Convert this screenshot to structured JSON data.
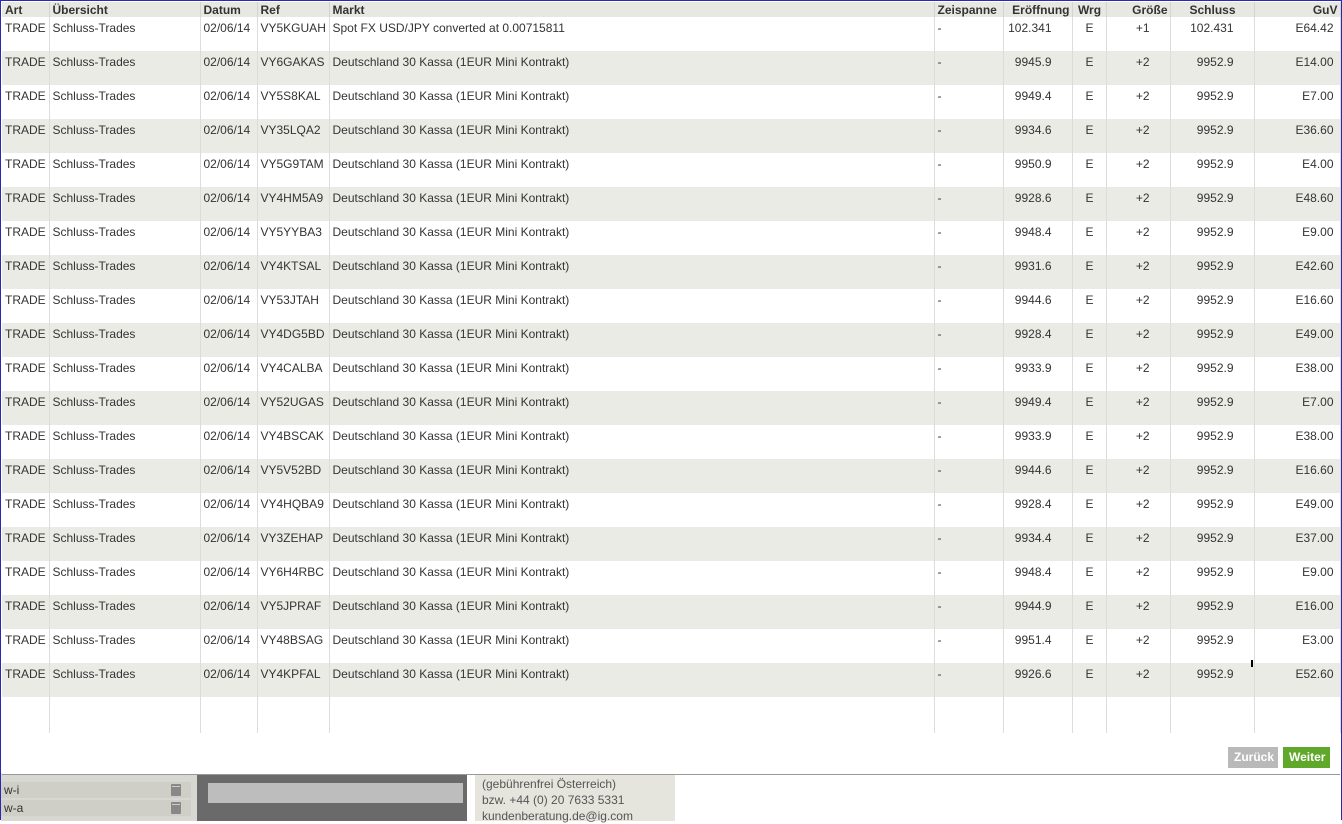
{
  "table": {
    "headers": {
      "art": "Art",
      "uebersicht": "Übersicht",
      "datum": "Datum",
      "ref": "Ref",
      "markt": "Markt",
      "zeispanne": "Zeispanne",
      "eroeffnung": "Eröffnung",
      "wrg": "Wrg",
      "groesse": "Größe",
      "schluss": "Schluss",
      "guv": "GuV"
    },
    "rows": [
      {
        "art": "TRADE",
        "uebersicht": "Schluss-Trades",
        "datum": "02/06/14",
        "ref": "VY5KGUAH",
        "markt": "Spot FX USD/JPY converted at 0.00715811",
        "zeispanne": "-",
        "eroeffnung": "102.341",
        "wrg": "E",
        "groesse": "+1",
        "schluss": "102.431",
        "guv": "E64.42"
      },
      {
        "art": "TRADE",
        "uebersicht": "Schluss-Trades",
        "datum": "02/06/14",
        "ref": "VY6GAKAS",
        "markt": "Deutschland 30 Kassa (1EUR Mini Kontrakt)",
        "zeispanne": "-",
        "eroeffnung": "9945.9",
        "wrg": "E",
        "groesse": "+2",
        "schluss": "9952.9",
        "guv": "E14.00"
      },
      {
        "art": "TRADE",
        "uebersicht": "Schluss-Trades",
        "datum": "02/06/14",
        "ref": "VY5S8KAL",
        "markt": "Deutschland 30 Kassa (1EUR Mini Kontrakt)",
        "zeispanne": "-",
        "eroeffnung": "9949.4",
        "wrg": "E",
        "groesse": "+2",
        "schluss": "9952.9",
        "guv": "E7.00"
      },
      {
        "art": "TRADE",
        "uebersicht": "Schluss-Trades",
        "datum": "02/06/14",
        "ref": "VY35LQA2",
        "markt": "Deutschland 30 Kassa (1EUR Mini Kontrakt)",
        "zeispanne": "-",
        "eroeffnung": "9934.6",
        "wrg": "E",
        "groesse": "+2",
        "schluss": "9952.9",
        "guv": "E36.60"
      },
      {
        "art": "TRADE",
        "uebersicht": "Schluss-Trades",
        "datum": "02/06/14",
        "ref": "VY5G9TAM",
        "markt": "Deutschland 30 Kassa (1EUR Mini Kontrakt)",
        "zeispanne": "-",
        "eroeffnung": "9950.9",
        "wrg": "E",
        "groesse": "+2",
        "schluss": "9952.9",
        "guv": "E4.00"
      },
      {
        "art": "TRADE",
        "uebersicht": "Schluss-Trades",
        "datum": "02/06/14",
        "ref": "VY4HM5A9",
        "markt": "Deutschland 30 Kassa (1EUR Mini Kontrakt)",
        "zeispanne": "-",
        "eroeffnung": "9928.6",
        "wrg": "E",
        "groesse": "+2",
        "schluss": "9952.9",
        "guv": "E48.60"
      },
      {
        "art": "TRADE",
        "uebersicht": "Schluss-Trades",
        "datum": "02/06/14",
        "ref": "VY5YYBA3",
        "markt": "Deutschland 30 Kassa (1EUR Mini Kontrakt)",
        "zeispanne": "-",
        "eroeffnung": "9948.4",
        "wrg": "E",
        "groesse": "+2",
        "schluss": "9952.9",
        "guv": "E9.00"
      },
      {
        "art": "TRADE",
        "uebersicht": "Schluss-Trades",
        "datum": "02/06/14",
        "ref": "VY4KTSAL",
        "markt": "Deutschland 30 Kassa (1EUR Mini Kontrakt)",
        "zeispanne": "-",
        "eroeffnung": "9931.6",
        "wrg": "E",
        "groesse": "+2",
        "schluss": "9952.9",
        "guv": "E42.60"
      },
      {
        "art": "TRADE",
        "uebersicht": "Schluss-Trades",
        "datum": "02/06/14",
        "ref": "VY53JTAH",
        "markt": "Deutschland 30 Kassa (1EUR Mini Kontrakt)",
        "zeispanne": "-",
        "eroeffnung": "9944.6",
        "wrg": "E",
        "groesse": "+2",
        "schluss": "9952.9",
        "guv": "E16.60"
      },
      {
        "art": "TRADE",
        "uebersicht": "Schluss-Trades",
        "datum": "02/06/14",
        "ref": "VY4DG5BD",
        "markt": "Deutschland 30 Kassa (1EUR Mini Kontrakt)",
        "zeispanne": "-",
        "eroeffnung": "9928.4",
        "wrg": "E",
        "groesse": "+2",
        "schluss": "9952.9",
        "guv": "E49.00"
      },
      {
        "art": "TRADE",
        "uebersicht": "Schluss-Trades",
        "datum": "02/06/14",
        "ref": "VY4CALBA",
        "markt": "Deutschland 30 Kassa (1EUR Mini Kontrakt)",
        "zeispanne": "-",
        "eroeffnung": "9933.9",
        "wrg": "E",
        "groesse": "+2",
        "schluss": "9952.9",
        "guv": "E38.00"
      },
      {
        "art": "TRADE",
        "uebersicht": "Schluss-Trades",
        "datum": "02/06/14",
        "ref": "VY52UGAS",
        "markt": "Deutschland 30 Kassa (1EUR Mini Kontrakt)",
        "zeispanne": "-",
        "eroeffnung": "9949.4",
        "wrg": "E",
        "groesse": "+2",
        "schluss": "9952.9",
        "guv": "E7.00"
      },
      {
        "art": "TRADE",
        "uebersicht": "Schluss-Trades",
        "datum": "02/06/14",
        "ref": "VY4BSCAK",
        "markt": "Deutschland 30 Kassa (1EUR Mini Kontrakt)",
        "zeispanne": "-",
        "eroeffnung": "9933.9",
        "wrg": "E",
        "groesse": "+2",
        "schluss": "9952.9",
        "guv": "E38.00"
      },
      {
        "art": "TRADE",
        "uebersicht": "Schluss-Trades",
        "datum": "02/06/14",
        "ref": "VY5V52BD",
        "markt": "Deutschland 30 Kassa (1EUR Mini Kontrakt)",
        "zeispanne": "-",
        "eroeffnung": "9944.6",
        "wrg": "E",
        "groesse": "+2",
        "schluss": "9952.9",
        "guv": "E16.60"
      },
      {
        "art": "TRADE",
        "uebersicht": "Schluss-Trades",
        "datum": "02/06/14",
        "ref": "VY4HQBA9",
        "markt": "Deutschland 30 Kassa (1EUR Mini Kontrakt)",
        "zeispanne": "-",
        "eroeffnung": "9928.4",
        "wrg": "E",
        "groesse": "+2",
        "schluss": "9952.9",
        "guv": "E49.00"
      },
      {
        "art": "TRADE",
        "uebersicht": "Schluss-Trades",
        "datum": "02/06/14",
        "ref": "VY3ZEHAP",
        "markt": "Deutschland 30 Kassa (1EUR Mini Kontrakt)",
        "zeispanne": "-",
        "eroeffnung": "9934.4",
        "wrg": "E",
        "groesse": "+2",
        "schluss": "9952.9",
        "guv": "E37.00"
      },
      {
        "art": "TRADE",
        "uebersicht": "Schluss-Trades",
        "datum": "02/06/14",
        "ref": "VY6H4RBC",
        "markt": "Deutschland 30 Kassa (1EUR Mini Kontrakt)",
        "zeispanne": "-",
        "eroeffnung": "9948.4",
        "wrg": "E",
        "groesse": "+2",
        "schluss": "9952.9",
        "guv": "E9.00"
      },
      {
        "art": "TRADE",
        "uebersicht": "Schluss-Trades",
        "datum": "02/06/14",
        "ref": "VY5JPRAF",
        "markt": "Deutschland 30 Kassa (1EUR Mini Kontrakt)",
        "zeispanne": "-",
        "eroeffnung": "9944.9",
        "wrg": "E",
        "groesse": "+2",
        "schluss": "9952.9",
        "guv": "E16.00"
      },
      {
        "art": "TRADE",
        "uebersicht": "Schluss-Trades",
        "datum": "02/06/14",
        "ref": "VY48BSAG",
        "markt": "Deutschland 30 Kassa (1EUR Mini Kontrakt)",
        "zeispanne": "-",
        "eroeffnung": "9951.4",
        "wrg": "E",
        "groesse": "+2",
        "schluss": "9952.9",
        "guv": "E3.00"
      },
      {
        "art": "TRADE",
        "uebersicht": "Schluss-Trades",
        "datum": "02/06/14",
        "ref": "VY4KPFAL",
        "markt": "Deutschland 30 Kassa (1EUR Mini Kontrakt)",
        "zeispanne": "-",
        "eroeffnung": "9926.6",
        "wrg": "E",
        "groesse": "+2",
        "schluss": "9952.9",
        "guv": "E52.60"
      }
    ]
  },
  "buttons": {
    "back_label": "Zurück",
    "next_label": "Weiter",
    "back_color": "#b9b9b9",
    "next_color": "#5fa82a"
  },
  "background": {
    "sidebar_rows": [
      "w-i",
      "w-a"
    ],
    "contact_lines": [
      "(gebührenfrei Österreich)",
      "bzw. +44 (0) 20 7633 5331",
      "kundenberatung.de@ig.com"
    ]
  }
}
